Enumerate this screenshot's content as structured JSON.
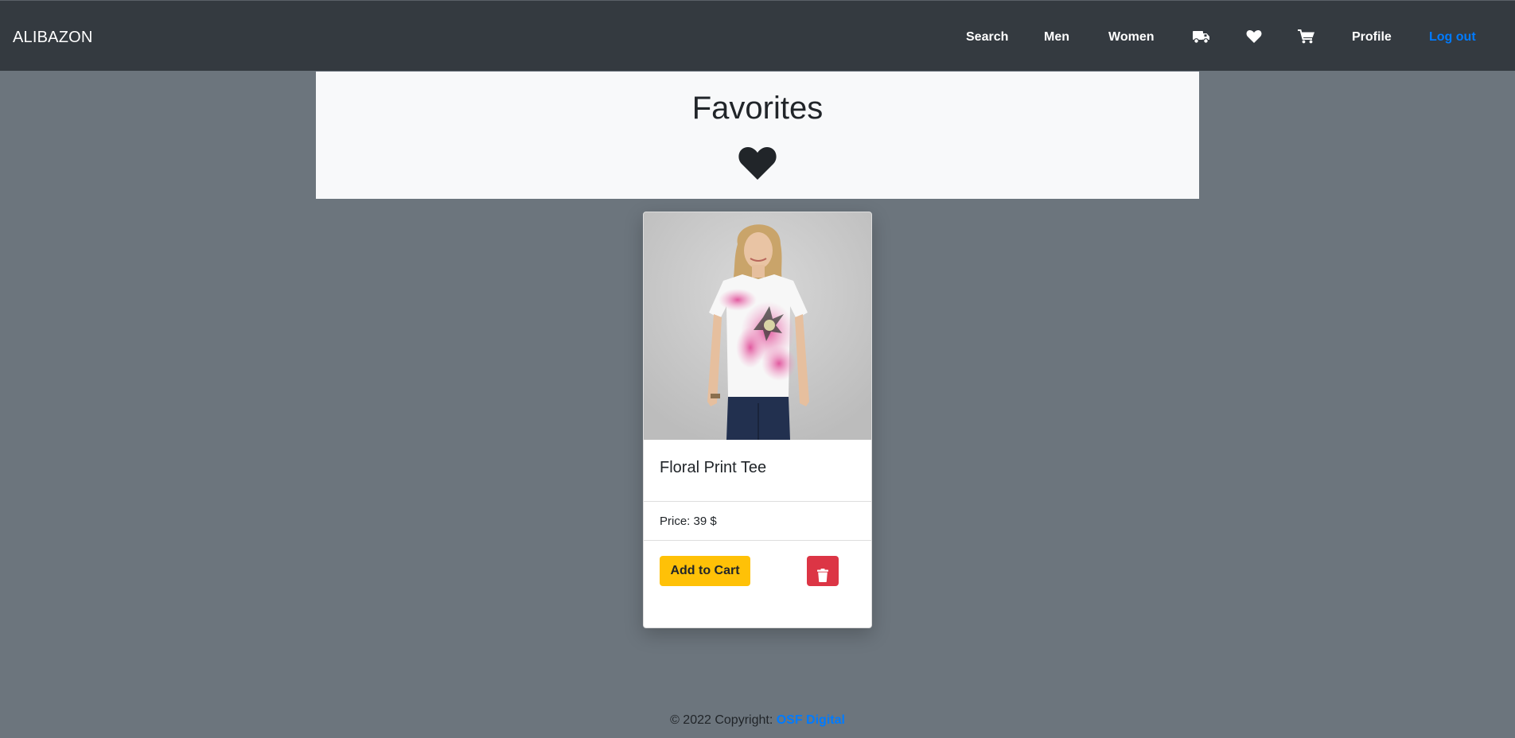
{
  "navbar": {
    "brand": "ALIBAZON",
    "links": {
      "search": "Search",
      "men": "Men",
      "women": "Women",
      "profile": "Profile",
      "logout": "Log out"
    },
    "icons": [
      "truck-icon",
      "heart-icon",
      "cart-icon"
    ],
    "logout_color": "#007bff"
  },
  "page": {
    "title": "Favorites",
    "title_icon": "heart-icon"
  },
  "favorites": [
    {
      "name": "Floral Print Tee",
      "price_text": "Price: 39 $",
      "add_to_cart_label": "Add to Cart",
      "delete_icon": "trash-icon"
    }
  ],
  "footer": {
    "copyright": "© 2022 Copyright: ",
    "company": "OSF Digital"
  },
  "colors": {
    "background": "#6c757d",
    "navbar": "#343a40",
    "add_to_cart": "#ffc107",
    "delete": "#dc3545",
    "link": "#007bff"
  }
}
